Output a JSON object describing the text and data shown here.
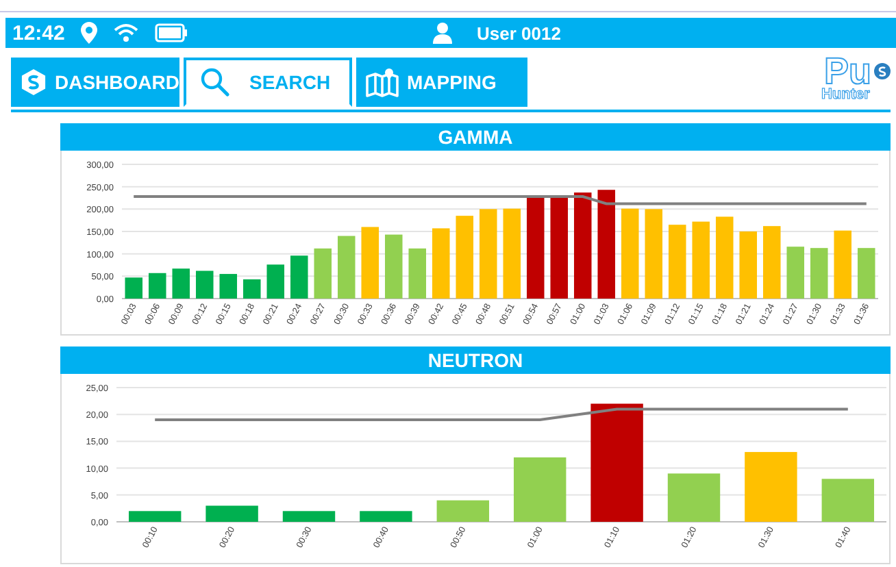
{
  "status_bar": {
    "time": "12:42",
    "user": "User 0012"
  },
  "tabs": [
    {
      "label": "DASHBOARD",
      "kind": "dashboard",
      "selected": false
    },
    {
      "label": "SEARCH",
      "kind": "search",
      "selected": true
    },
    {
      "label": "MAPPING",
      "kind": "mapping",
      "selected": false
    }
  ],
  "logo": {
    "title": "Pu",
    "subtitle": "Hunter"
  },
  "charts": [
    {
      "title": "GAMMA",
      "chart_data": {
        "type": "bar",
        "grid": true,
        "categories": [
          "00:03",
          "00:06",
          "00:09",
          "00:12",
          "00:15",
          "00:18",
          "00:21",
          "00:24",
          "00:27",
          "00:30",
          "00:33",
          "00:36",
          "00:39",
          "00:42",
          "00:45",
          "00:48",
          "00:51",
          "00:54",
          "00:57",
          "01:00",
          "01:03",
          "01:06",
          "01:09",
          "01:12",
          "01:15",
          "01:18",
          "01:21",
          "01:24",
          "01:27",
          "01:30",
          "01:33",
          "01:36"
        ],
        "series": [
          {
            "values": [
              47,
              57,
              67,
              62,
              55,
              43,
              76,
              96,
              112,
              140,
              160,
              143,
              112,
              157,
              185,
              200,
              201,
              230,
              229,
              237,
              243,
              201,
              200,
              165,
              172,
              183,
              150,
              162,
              116,
              113,
              152,
              113
            ],
            "colors": [
              "#00b050",
              "#00b050",
              "#00b050",
              "#00b050",
              "#00b050",
              "#00b050",
              "#00b050",
              "#00b050",
              "#92d050",
              "#92d050",
              "#ffc000",
              "#92d050",
              "#92d050",
              "#ffc000",
              "#ffc000",
              "#ffc000",
              "#ffc000",
              "#c00000",
              "#c00000",
              "#c00000",
              "#c00000",
              "#ffc000",
              "#ffc000",
              "#ffc000",
              "#ffc000",
              "#ffc000",
              "#ffc000",
              "#ffc000",
              "#92d050",
              "#92d050",
              "#ffc000",
              "#92d050"
            ]
          },
          {
            "type": "line",
            "color": "#808080",
            "values": [
              228,
              228,
              228,
              228,
              228,
              228,
              228,
              228,
              228,
              228,
              228,
              228,
              228,
              228,
              228,
              228,
              228,
              228,
              228,
              228,
              212,
              212,
              212,
              212,
              212,
              212,
              212,
              212,
              212,
              212,
              212,
              212
            ]
          }
        ],
        "ylim": [
          0,
          300
        ],
        "yticks": [
          {
            "value": 0,
            "label": "0,00"
          },
          {
            "value": 50,
            "label": "50,00"
          },
          {
            "value": 100,
            "label": "100,00"
          },
          {
            "value": 150,
            "label": "150,00"
          },
          {
            "value": 200,
            "label": "200,00"
          },
          {
            "value": 250,
            "label": "250,00"
          },
          {
            "value": 300,
            "label": "300,00"
          }
        ]
      }
    },
    {
      "title": "NEUTRON",
      "chart_data": {
        "type": "bar",
        "grid": true,
        "categories": [
          "00:10",
          "00:20",
          "00:30",
          "00:40",
          "00:50",
          "01:00",
          "01:10",
          "01:20",
          "01:30",
          "01:40"
        ],
        "series": [
          {
            "values": [
              2,
              3,
              2,
              2,
              4,
              12,
              22,
              9,
              13,
              8
            ],
            "colors": [
              "#00b050",
              "#00b050",
              "#00b050",
              "#00b050",
              "#92d050",
              "#92d050",
              "#c00000",
              "#92d050",
              "#ffc000",
              "#92d050"
            ]
          },
          {
            "type": "line",
            "color": "#808080",
            "values": [
              19,
              19,
              19,
              19,
              19,
              19,
              21,
              21,
              21,
              21
            ]
          }
        ],
        "ylim": [
          0,
          25
        ],
        "yticks": [
          {
            "value": 0,
            "label": "0,00"
          },
          {
            "value": 5,
            "label": "5,00"
          },
          {
            "value": 10,
            "label": "10,00"
          },
          {
            "value": 15,
            "label": "15,00"
          },
          {
            "value": 20,
            "label": "20,00"
          },
          {
            "value": 25,
            "label": "25,00"
          }
        ]
      }
    }
  ]
}
